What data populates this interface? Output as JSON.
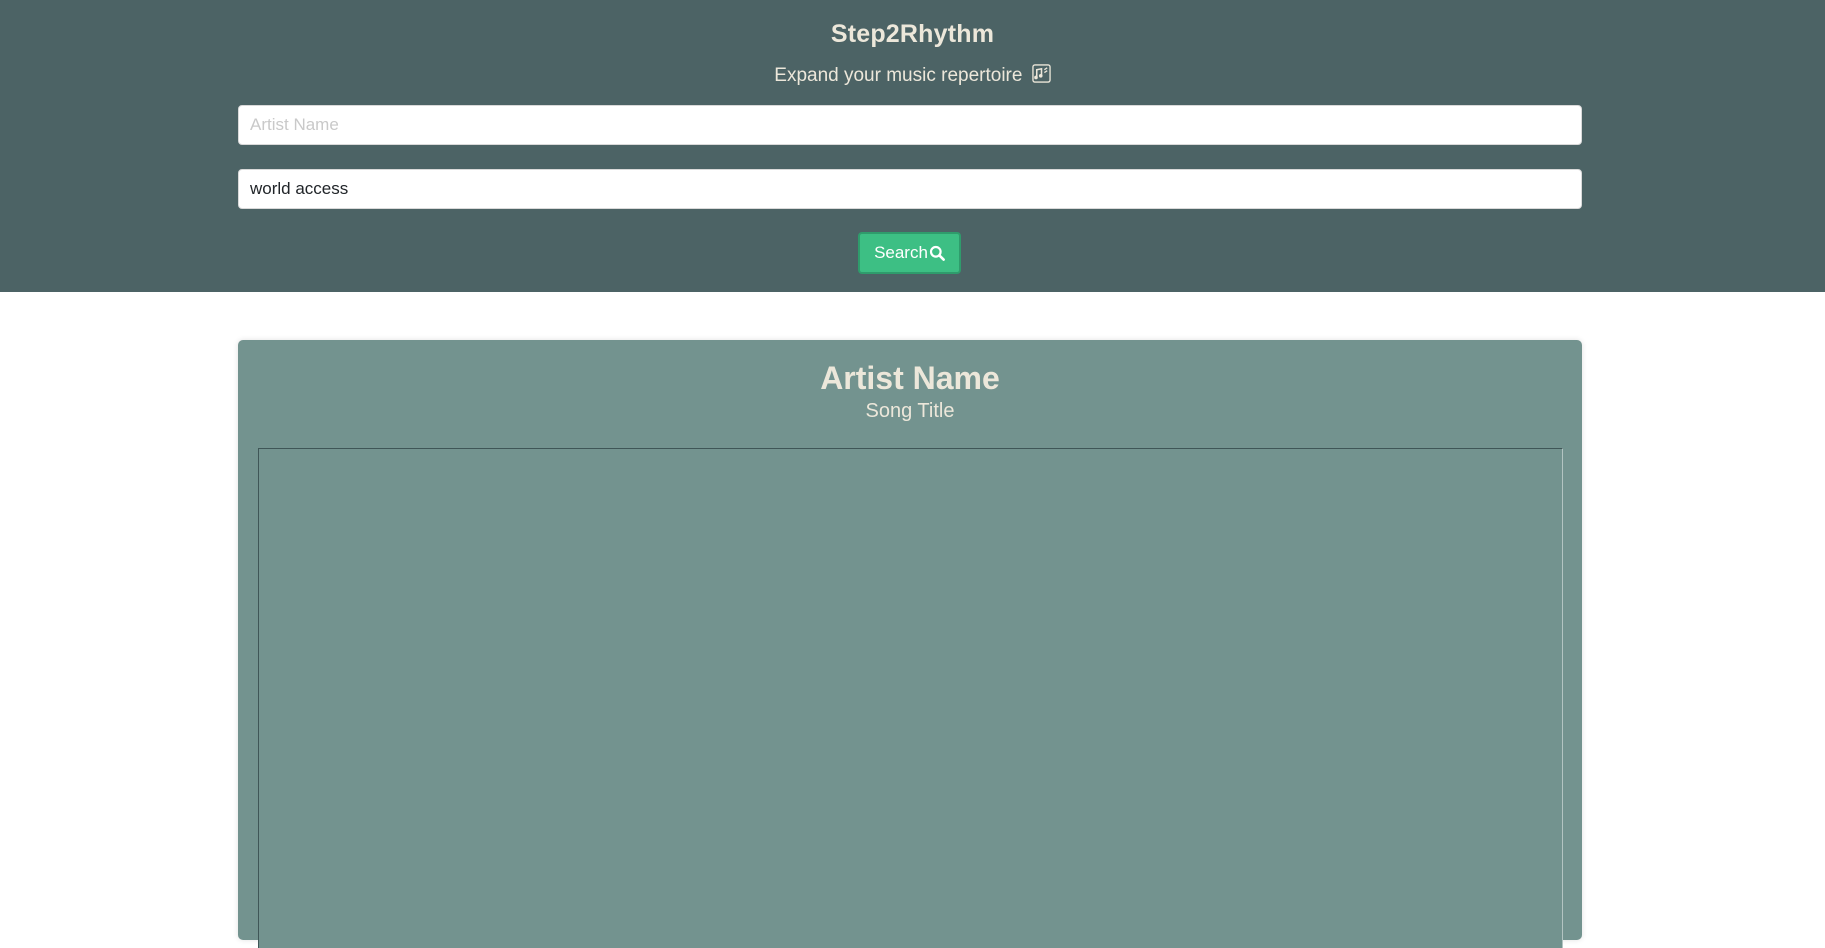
{
  "header": {
    "title": "Step2Rhythm",
    "tagline": "Expand your music repertoire",
    "tagline_icon": "music-notes-icon"
  },
  "search": {
    "artist_placeholder": "Artist Name",
    "artist_value": "",
    "song_value": "world access",
    "button_label": "Search",
    "button_icon": "search-icon"
  },
  "result": {
    "artist": "Artist Name",
    "song": "Song Title",
    "lyrics": ""
  },
  "colors": {
    "header_bg": "#4c6365",
    "card_bg": "#73938f",
    "accent": "#3dbf84",
    "text_light": "#ece7da"
  }
}
